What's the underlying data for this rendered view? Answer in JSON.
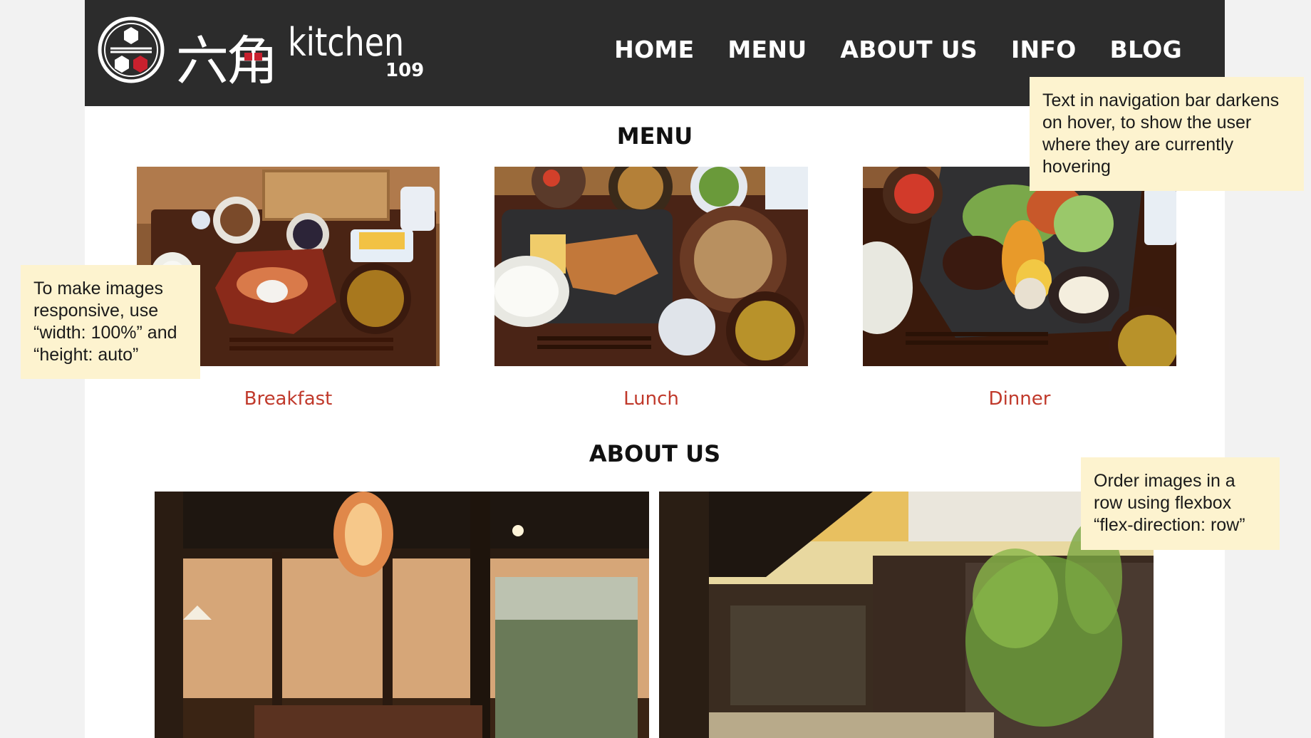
{
  "brand": {
    "kanji": "六角",
    "name": "kitchen",
    "number": "109"
  },
  "nav": {
    "items": [
      {
        "label": "HOME"
      },
      {
        "label": "MENU"
      },
      {
        "label": "ABOUT US"
      },
      {
        "label": "INFO"
      },
      {
        "label": "BLOG"
      }
    ]
  },
  "menu_section": {
    "title": "MENU",
    "items": [
      {
        "caption": "Breakfast"
      },
      {
        "caption": "Lunch"
      },
      {
        "caption": "Dinner"
      }
    ]
  },
  "about_section": {
    "title": "ABOUT US"
  },
  "notes": {
    "nav_hover": "Text in navigation bar darkens on hover, to show the user where they are currently hovering",
    "responsive_images": "To make images responsive, use “width: 100%” and “height: auto”",
    "flex_row": "Order images in a row using flexbox “flex-direction: row”"
  },
  "colors": {
    "navbar": "#2c2c2c",
    "nav_text": "#ffffff",
    "caption": "#c0392b",
    "note_bg": "#fdf3cf",
    "logo_red": "#c8202e"
  }
}
